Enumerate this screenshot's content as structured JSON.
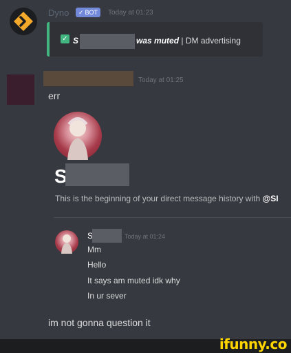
{
  "dyno_message": {
    "author": "Dyno",
    "bot_tag": "BOT",
    "bot_check": "✓",
    "timestamp": "Today at 01:23",
    "embed": {
      "prefix": "S",
      "muted_text": "was muted",
      "separator": "|",
      "reason": "DM advertising",
      "accent_color": "#43b581"
    }
  },
  "user_message": {
    "timestamp": "Today at 01:25",
    "text": "err"
  },
  "dm_screenshot": {
    "username_initial": "S",
    "history_text": "This is the beginning of your direct message history with",
    "history_mention": "@SI",
    "message": {
      "author_initial": "S",
      "timestamp": "Today at 01:24",
      "lines": [
        "Mm",
        "Hello",
        "It says am muted idk why",
        "In ur sever"
      ]
    }
  },
  "final_message": "im not gonna question it",
  "watermark": "ifunny.co"
}
